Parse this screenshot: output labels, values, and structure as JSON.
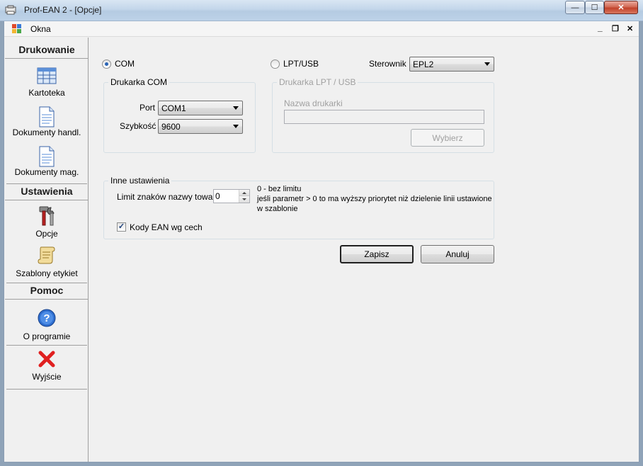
{
  "window": {
    "title": "Prof-EAN  2 - [Opcje]",
    "min_glyph": "—",
    "max_glyph": "☐",
    "close_glyph": "✕"
  },
  "menubar": {
    "okna_label": "Okna",
    "mdi_min": "_",
    "mdi_restore": "❐",
    "mdi_close": "✕"
  },
  "sidebar": {
    "sections": {
      "drukowanie": "Drukowanie",
      "ustawienia": "Ustawienia",
      "pomoc": "Pomoc"
    },
    "items": {
      "kartoteka": "Kartoteka",
      "dokumenty_handl": "Dokumenty handl.",
      "dokumenty_mag": "Dokumenty mag.",
      "opcje": "Opcje",
      "szablony": "Szablony etykiet",
      "o_programie": "O programie",
      "wyjscie": "Wyjście"
    }
  },
  "options": {
    "com_label": "COM",
    "com_checked": true,
    "lpt_label": "LPT/USB",
    "lpt_checked": false,
    "sterownik_label": "Sterownik",
    "sterownik_value": "EPL2",
    "drukarka_com": {
      "title": "Drukarka COM",
      "port_label": "Port",
      "port_value": "COM1",
      "speed_label": "Szybkość",
      "speed_value": "9600"
    },
    "drukarka_lpt": {
      "title": "Drukarka LPT / USB",
      "name_label": "Nazwa drukarki",
      "name_value": "",
      "choose_button": "Wybierz"
    },
    "inne": {
      "title": "Inne ustawienia",
      "limit_label": "Limit znaków nazwy towaru:",
      "limit_value": "0",
      "hint_line1": "0 - bez limitu",
      "hint_line2": "jeśli parametr > 0 to ma wyższy priorytet niż dzielenie linii ustawione",
      "hint_line3": "w szablonie",
      "kody_ean_label": "Kody EAN wg cech",
      "kody_ean_checked": true,
      "check_glyph": "✓"
    },
    "save_button": "Zapisz",
    "cancel_button": "Anuluj"
  },
  "colors": {
    "title_gradient_top": "#d9e6f3",
    "close_button": "#c2422b",
    "radio_dot": "#2a64b5",
    "window_bg": "#f0f0f0"
  }
}
